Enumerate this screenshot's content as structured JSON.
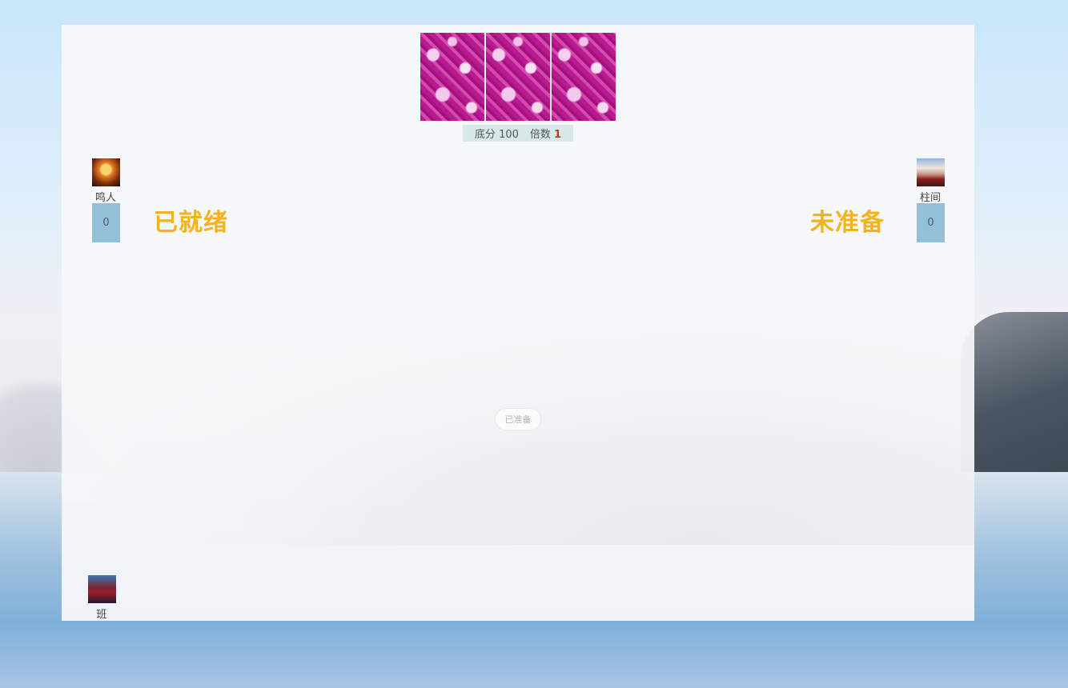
{
  "table": {
    "deck_cards": 3,
    "base_score_label": "底分",
    "base_score_value": "100",
    "multiplier_label": "倍数",
    "multiplier_value": "1"
  },
  "players": {
    "left": {
      "name": "鸣人",
      "card_count": "0",
      "status": "已就绪",
      "avatar": "naruto-avatar"
    },
    "right": {
      "name": "柱间",
      "card_count": "0",
      "status": "未准备",
      "avatar": "hashirama-avatar"
    },
    "self": {
      "name": "班",
      "avatar": "madara-avatar"
    }
  },
  "controls": {
    "ready_button_label": "已准备"
  },
  "colors": {
    "status_text": "#f6b21a",
    "count_box": "#93bfd8",
    "score_bar": "#d7e8e8",
    "card_back": "#b5198c"
  }
}
